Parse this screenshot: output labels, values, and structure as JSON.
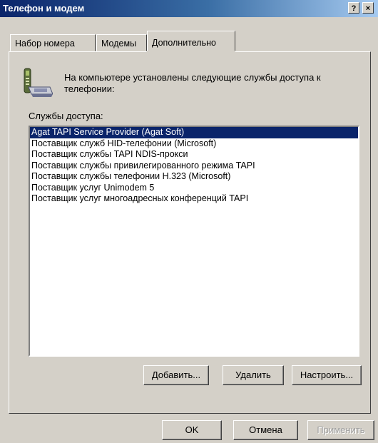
{
  "window": {
    "title": "Телефон и модем",
    "help_button": "?",
    "close_button": "×"
  },
  "tabs": [
    {
      "label": "Набор номера",
      "active": false
    },
    {
      "label": "Модемы",
      "active": false
    },
    {
      "label": "Дополнительно",
      "active": true
    }
  ],
  "advanced": {
    "icon": "telephone-computer-icon",
    "intro_text": "На компьютере установлены следующие службы доступа к телефонии:",
    "services_label": "Службы доступа:",
    "services": [
      {
        "name": "Agat TAPI Service Provider (Agat Soft)",
        "selected": true
      },
      {
        "name": "Поставщик служб HID-телефонии (Microsoft)",
        "selected": false
      },
      {
        "name": "Поставщик службы TAPI NDIS-прокси",
        "selected": false
      },
      {
        "name": "Поставщик службы привилегированного режима TAPI",
        "selected": false
      },
      {
        "name": "Поставщик службы телефонии H.323 (Microsoft)",
        "selected": false
      },
      {
        "name": "Поставщик услуг Unimodem 5",
        "selected": false
      },
      {
        "name": "Поставщик услуг многоадресных конференций TAPI",
        "selected": false
      }
    ],
    "add_button": "Добавить...",
    "remove_button": "Удалить",
    "configure_button": "Настроить..."
  },
  "footer": {
    "ok_button": "OK",
    "cancel_button": "Отмена",
    "apply_button": "Применить",
    "apply_enabled": false
  },
  "colors": {
    "title_bar": "#0a246a",
    "selection": "#0a246a",
    "face": "#d4d0c8"
  }
}
